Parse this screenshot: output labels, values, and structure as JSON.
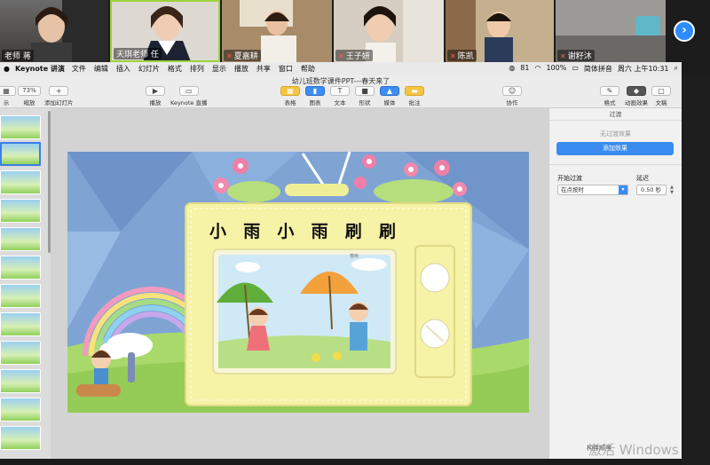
{
  "participants": [
    {
      "name": "老师 蒋",
      "muted": false
    },
    {
      "name": "天琪老师 任",
      "muted": false
    },
    {
      "name": "夏嘉耕",
      "muted": true
    },
    {
      "name": "王子妍",
      "muted": true
    },
    {
      "name": "陈凯",
      "muted": true
    },
    {
      "name": "谢籽沐",
      "muted": true
    }
  ],
  "menubar": {
    "app": "Keynote 讲演",
    "items": [
      "文件",
      "编辑",
      "插入",
      "幻灯片",
      "格式",
      "排列",
      "显示",
      "播放",
      "共享",
      "窗口",
      "帮助"
    ],
    "right": [
      "81",
      "100%",
      "简体拼音",
      "周六 上午10:31"
    ]
  },
  "toolbar": {
    "doc_title": "幼儿班数学课件PPT---春天来了",
    "zoom": "73%",
    "view_label": "示",
    "zoom_label": "缩放",
    "add_slide": "添加幻灯片",
    "play": "播放",
    "live": "Keynote 直播",
    "table": "表格",
    "chart": "图表",
    "text": "文本",
    "shape": "形状",
    "media": "媒体",
    "comment": "批注",
    "collab": "协作",
    "format": "格式",
    "animate": "动画效果",
    "document": "文稿"
  },
  "slide": {
    "title_chars": [
      "小",
      "雨",
      "小",
      "雨",
      "刷",
      "刷"
    ],
    "pic_caption": "春雨"
  },
  "inspector": {
    "header": "过渡",
    "no_effect": "无过渡效果",
    "add_effect": "添加效果",
    "start_label": "开始过渡",
    "start_value": "在点按时",
    "delay_label": "延迟",
    "delay_value": "0.50 秒",
    "bottom": "构件顺序",
    "watermark": "激活 Windows"
  },
  "colors": {
    "accent": "#3a8cf0",
    "tv_body": "#f6f2a6",
    "grass": "#a9d96b"
  }
}
